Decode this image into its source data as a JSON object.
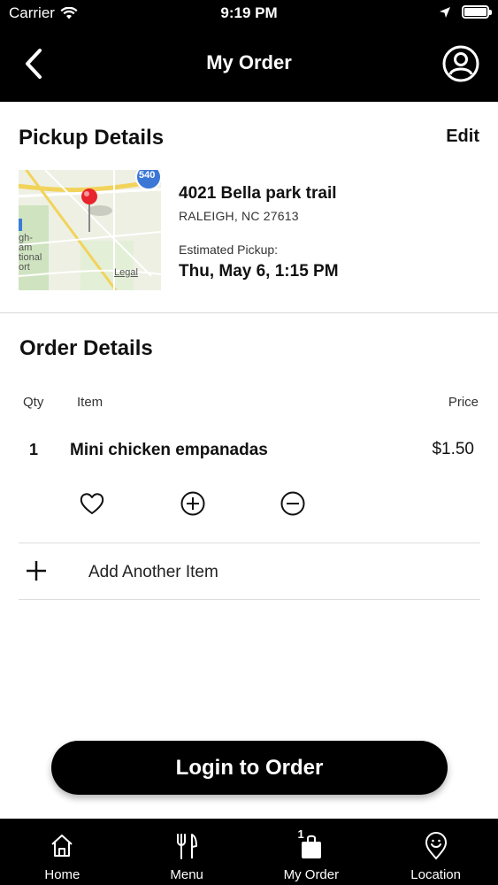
{
  "status_bar": {
    "carrier": "Carrier",
    "time": "9:19 PM"
  },
  "header": {
    "title": "My Order"
  },
  "pickup": {
    "title": "Pickup Details",
    "edit_label": "Edit",
    "map": {
      "road_badge": "540",
      "legal": "Legal",
      "label_left": "gh-\nam\ntional\nort"
    },
    "address_line1": "4021 Bella park trail",
    "address_line2": "RALEIGH, NC 27613",
    "estimated_label": "Estimated Pickup:",
    "estimated_time": "Thu, May 6, 1:15 PM"
  },
  "order": {
    "title": "Order Details",
    "columns": {
      "qty": "Qty",
      "item": "Item",
      "price": "Price"
    },
    "items": [
      {
        "qty": "1",
        "name": "Mini chicken empanadas",
        "price": "$1.50"
      }
    ],
    "add_item_label": "Add Another Item"
  },
  "login_button": "Login to Order",
  "tabbar": {
    "tabs": [
      {
        "label": "Home",
        "icon": "home-icon"
      },
      {
        "label": "Menu",
        "icon": "fork-knife-icon"
      },
      {
        "label": "My Order",
        "icon": "bag-icon",
        "badge": "1"
      },
      {
        "label": "Location",
        "icon": "location-pin-icon"
      }
    ]
  },
  "colors": {
    "bar_background": "#000000",
    "pin": "#e8252c",
    "map_road": "#f2d35a"
  }
}
